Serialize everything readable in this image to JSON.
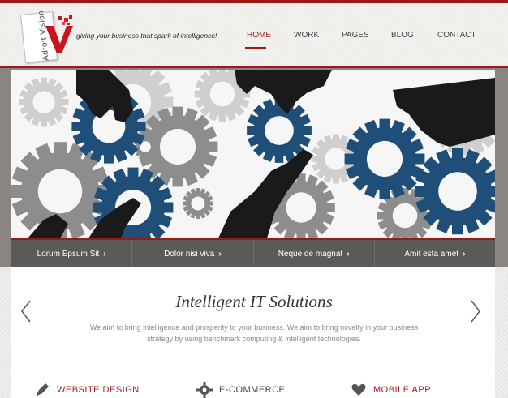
{
  "brand": {
    "logo_text": "Adroit Vision",
    "tagline": "giving your business that spark of intelligence!"
  },
  "nav": {
    "items": [
      {
        "label": "HOME",
        "active": true
      },
      {
        "label": "WORK",
        "active": false
      },
      {
        "label": "PAGES",
        "active": false
      },
      {
        "label": "BLOG",
        "active": false
      },
      {
        "label": "CONTACT",
        "active": false
      }
    ]
  },
  "hero": {
    "illustration": "gears-and-hands"
  },
  "quick_links": [
    {
      "label": "Lorum Epsum Sit",
      "icon": "chevron-right-icon"
    },
    {
      "label": "Dolor nisi viva",
      "icon": "chevron-right-icon"
    },
    {
      "label": "Neque de magnat",
      "icon": "chevron-right-icon"
    },
    {
      "label": "Amit esta amet",
      "icon": "chevron-right-icon"
    }
  ],
  "intro": {
    "title": "Intelligent IT Solutions",
    "text": "We aim to bring intelligence and prosperity to your business. We aim to bring novelty in your business strategy by using benchmark computing & intelligent technologies."
  },
  "slider": {
    "prev_icon": "chevron-left-icon",
    "next_icon": "chevron-right-icon"
  },
  "features": [
    {
      "label": "WEBSITE DESIGN",
      "icon": "pen-icon"
    },
    {
      "label": "E-COMMERCE",
      "icon": "gear-icon"
    },
    {
      "label": "MOBILE APP",
      "icon": "heart-icon"
    }
  ],
  "colors": {
    "accent": "#9b1b14",
    "gear_blue": "#1f4f78",
    "gear_gray": "#8d8d8d",
    "bar_gray": "#5a5a58"
  }
}
